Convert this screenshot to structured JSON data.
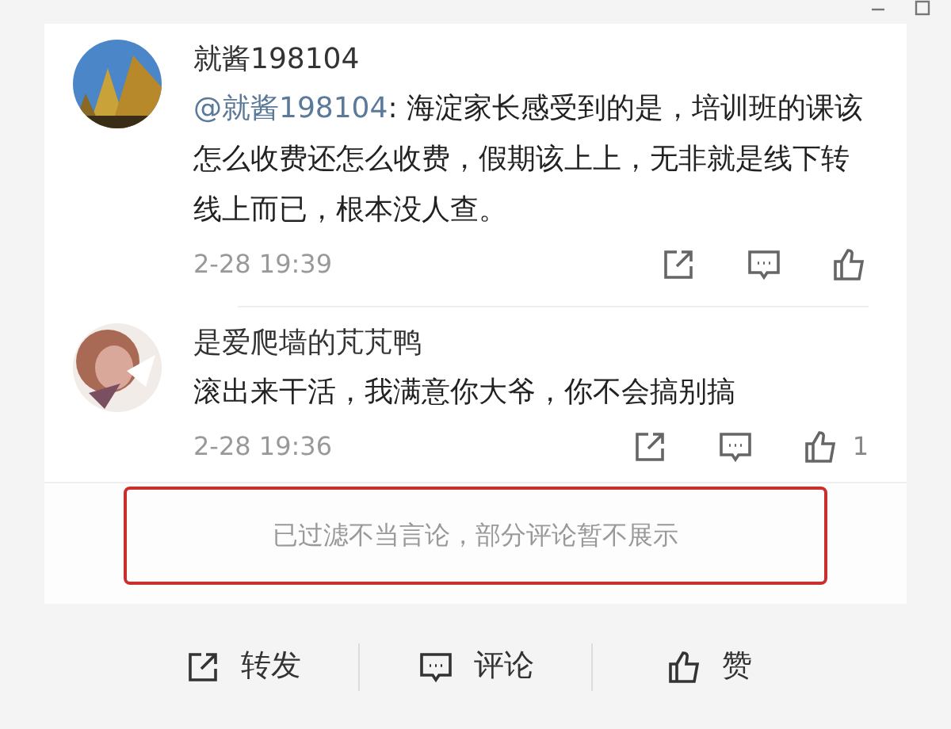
{
  "comments": [
    {
      "user": "就酱198104",
      "mention": "@就酱198104",
      "text": ": 海淀家长感受到的是，培训班的课该怎么收费还怎么收费，假期该上上，无非就是线下转线上而已，根本没人查。",
      "time": "2-28 19:39"
    },
    {
      "user": "是爱爬墙的芃芃鸭",
      "text": "滚出来干活，我满意你大爷，你不会搞别搞",
      "time": "2-28 19:36",
      "likes": "1"
    }
  ],
  "notice": "已过滤不当言论，部分评论暂不展示",
  "actions": [
    {
      "kind": "share",
      "label": "转发"
    },
    {
      "kind": "comment",
      "label": "评论"
    },
    {
      "kind": "like",
      "label": "赞"
    }
  ]
}
